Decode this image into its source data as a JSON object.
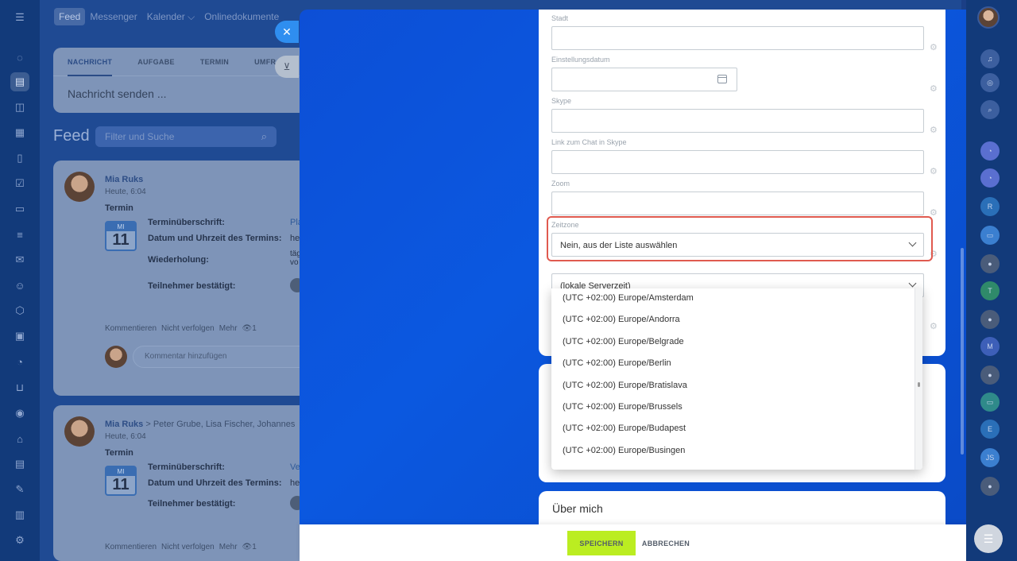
{
  "left_rail": {
    "icons": [
      "menu-icon",
      "activity-icon",
      "feed-icon",
      "chat-icon",
      "calendar-icon",
      "documents-icon",
      "tasks-icon",
      "crm-icon",
      "filter-icon",
      "mail-icon",
      "contacts-icon",
      "automation-icon",
      "sites-icon",
      "analytics-icon",
      "shop-icon",
      "marketing-icon",
      "bot-icon",
      "database-icon",
      "signature-icon",
      "reports-icon",
      "settings-icon"
    ]
  },
  "top_nav": {
    "items": [
      "Feed",
      "Messenger",
      "Kalender ⌵",
      "Onlinedokumente"
    ]
  },
  "composer": {
    "tabs": [
      "NACHRICHT",
      "AUFGABE",
      "TERMIN",
      "UMFR"
    ],
    "placeholder": "Nachricht senden ..."
  },
  "feed": {
    "title": "Feed",
    "search_placeholder": "Filter und Suche"
  },
  "posts": [
    {
      "author": "Mia Ruks",
      "recipients": "",
      "time": "Heute, 6:04",
      "type": "Termin",
      "cal_day": "MI",
      "cal_num": "11",
      "fields": [
        {
          "label": "Terminüberschrift:",
          "value": "Pla"
        },
        {
          "label": "Datum und Uhrzeit des Termins:",
          "value": "he"
        },
        {
          "label": "Wiederholung:",
          "value": "täg vo"
        },
        {
          "label": "Teilnehmer bestätigt:",
          "value": ""
        }
      ],
      "actions": [
        "Kommentieren",
        "Nicht verfolgen",
        "Mehr",
        "👁1"
      ],
      "comment_placeholder": "Kommentar hinzufügen"
    },
    {
      "author": "Mia Ruks",
      "recipients": "> Peter Grube, Lisa Fischer, Johannes",
      "time": "Heute, 6:04",
      "type": "Termin",
      "cal_day": "MI",
      "cal_num": "11",
      "fields": [
        {
          "label": "Terminüberschrift:",
          "value": "Ve"
        },
        {
          "label": "Datum und Uhrzeit des Termins:",
          "value": "he"
        },
        {
          "label": "Teilnehmer bestätigt:",
          "value": ""
        }
      ],
      "actions": [
        "Kommentieren",
        "Nicht verfolgen",
        "Mehr",
        "👁1"
      ]
    }
  ],
  "form": {
    "fields": [
      {
        "label": "Stadt",
        "value": ""
      },
      {
        "label": "Einstellungsdatum",
        "value": ""
      },
      {
        "label": "Skype",
        "value": ""
      },
      {
        "label": "Link zum Chat in Skype",
        "value": ""
      },
      {
        "label": "Zoom",
        "value": ""
      }
    ],
    "timezone_label": "Zeitzone",
    "timezone_value": "Nein, aus der Liste auswählen",
    "server_time_value": "(lokale Serverzeit)",
    "dropdown_options": [
      "(UTC +02:00) Europe/Amsterdam",
      "(UTC +02:00) Europe/Andorra",
      "(UTC +02:00) Europe/Belgrade",
      "(UTC +02:00) Europe/Berlin",
      "(UTC +02:00) Europe/Bratislava",
      "(UTC +02:00) Europe/Brussels",
      "(UTC +02:00) Europe/Budapest",
      "(UTC +02:00) Europe/Busingen"
    ],
    "about_title": "Über mich"
  },
  "footer": {
    "save_label": "SPEICHERN",
    "cancel_label": "ABBRECHEN"
  },
  "right_rail": {
    "items": [
      {
        "name": "notifications-icon",
        "glyph": "🔔"
      },
      {
        "name": "target-icon",
        "glyph": "◎"
      },
      {
        "name": "search-chat-icon",
        "glyph": "⌕"
      },
      {
        "name": "channel-icon",
        "glyph": "◔"
      },
      {
        "name": "channel-icon",
        "glyph": "◔"
      },
      {
        "name": "avatar-r",
        "glyph": "R"
      },
      {
        "name": "chat-avatar",
        "glyph": "▭"
      },
      {
        "name": "user-avatar",
        "glyph": "●"
      },
      {
        "name": "avatar-t",
        "glyph": "T"
      },
      {
        "name": "user-avatar",
        "glyph": "●"
      },
      {
        "name": "avatar-m",
        "glyph": "M"
      },
      {
        "name": "user-avatar",
        "glyph": "●"
      },
      {
        "name": "chat-avatar",
        "glyph": "▭"
      },
      {
        "name": "avatar-e",
        "glyph": "E"
      },
      {
        "name": "avatar-js",
        "glyph": "JS"
      },
      {
        "name": "user-avatar",
        "glyph": "●"
      }
    ]
  }
}
